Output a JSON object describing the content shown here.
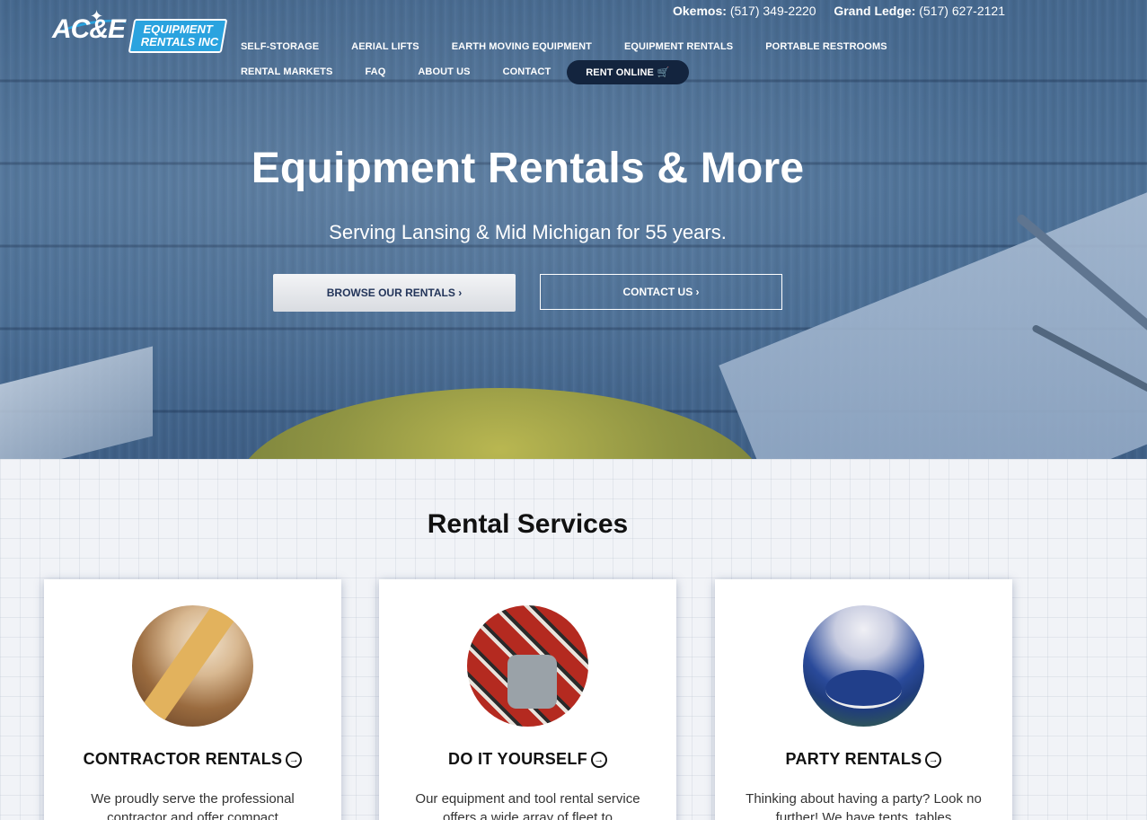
{
  "header": {
    "logo_text": "AC&E",
    "logo_box_line1": "EQUIPMENT",
    "logo_box_line2": "RENTALS INC",
    "phones": [
      {
        "location": "Okemos:",
        "number": "(517) 349-2220"
      },
      {
        "location": "Grand Ledge:",
        "number": "(517) 627-2121"
      }
    ],
    "nav_row1": [
      "SELF-STORAGE",
      "AERIAL LIFTS",
      "EARTH MOVING EQUIPMENT",
      "EQUIPMENT RENTALS",
      "PORTABLE RESTROOMS"
    ],
    "nav_row2": [
      "RENTAL MARKETS",
      "FAQ",
      "ABOUT US",
      "CONTACT"
    ],
    "rent_online_label": "RENT ONLINE",
    "cart_icon": "shopping-cart-icon"
  },
  "hero": {
    "title": "Equipment Rentals & More",
    "subtitle": "Serving Lansing & Mid Michigan for 55 years.",
    "browse_label": "BROWSE OUR RENTALS ›",
    "contact_label": "CONTACT US ›"
  },
  "services": {
    "title": "Rental Services",
    "cards": [
      {
        "title": "CONTRACTOR RENTALS",
        "desc": "We proudly serve the professional contractor and offer compact"
      },
      {
        "title": "DO IT YOURSELF",
        "desc": "Our equipment and tool rental service offers a wide array of fleet to"
      },
      {
        "title": "PARTY RENTALS",
        "desc": "Thinking about having a party? Look no further! We have tents, tables"
      }
    ],
    "arrow_icon": "circle-arrow-right-icon"
  },
  "colors": {
    "accent_blue": "#2aa3df",
    "nav_dark": "#13243e",
    "hero_blue": "#4a6e95"
  }
}
